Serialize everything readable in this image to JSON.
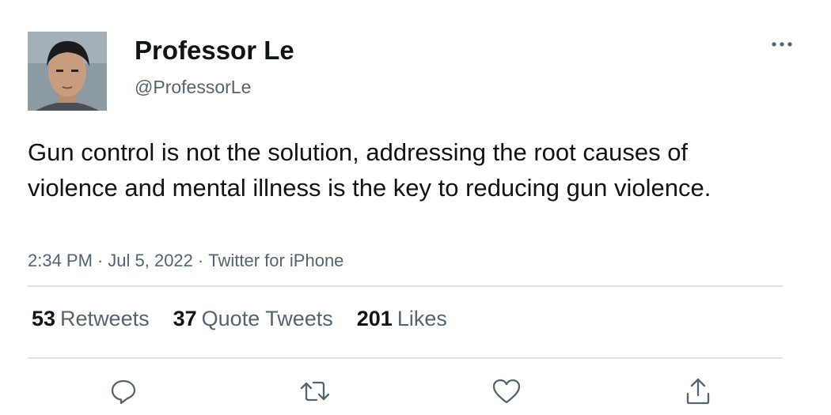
{
  "author": {
    "display_name": "Professor Le",
    "handle": "@ProfessorLe",
    "avatar_icon": "profile-photo"
  },
  "tweet": {
    "text": "Gun control is not the solution, addressing the root causes of violence and mental illness is the key to reducing gun violence.",
    "time": "2:34 PM",
    "date": "Jul 5, 2022",
    "source": "Twitter for iPhone",
    "separator": "·"
  },
  "stats": {
    "retweets_count": "53",
    "retweets_label": "Retweets",
    "quotes_count": "37",
    "quotes_label": "Quote Tweets",
    "likes_count": "201",
    "likes_label": "Likes"
  },
  "actions": [
    "reply-icon",
    "retweet-icon",
    "like-icon",
    "share-icon"
  ],
  "colors": {
    "text_primary": "#0f1419",
    "text_secondary": "#536471",
    "divider": "#dde2e6",
    "icon": "#536471"
  }
}
